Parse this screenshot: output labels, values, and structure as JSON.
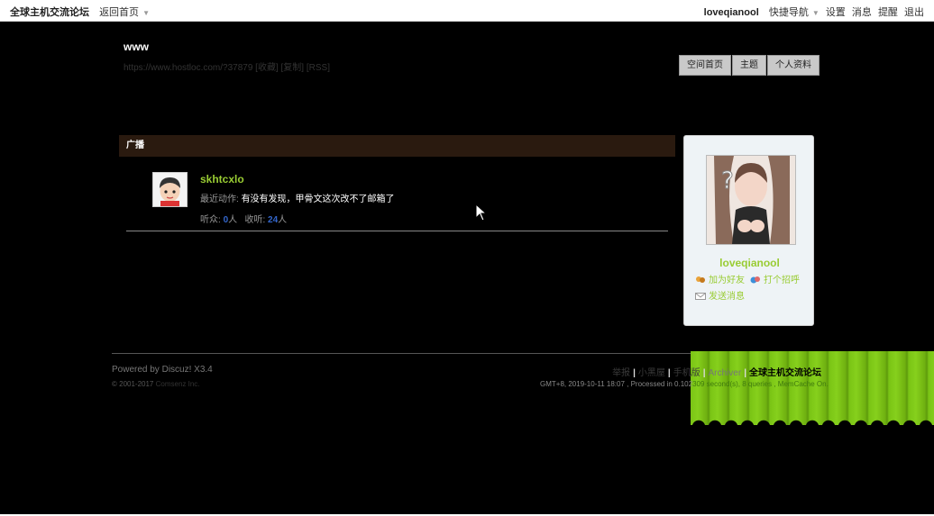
{
  "topbar": {
    "site_name": "全球主机交流论坛",
    "home": "返回首页",
    "username": "loveqianool",
    "quick_nav": "快捷导航",
    "settings": "设置",
    "messages": "消息",
    "reminders": "提醒",
    "logout": "退出"
  },
  "space": {
    "title": "www",
    "url": "https://www.hostloc.com/?37879 [收藏] [复制] [RSS]"
  },
  "nav_tabs": [
    "空间首页",
    "主题",
    "个人资料"
  ],
  "feed": {
    "header": "广播",
    "user": "skhtcxlo",
    "action_label": "最近动作:",
    "action_text": "有没有发现，甲骨文这次改不了邮箱了",
    "listeners_label": "听众:",
    "listeners": "0",
    "listening_label": "收听:",
    "listening": "24",
    "unit": "人"
  },
  "profile": {
    "name": "loveqianool",
    "add_friend": "加为好友",
    "greet": "打个招呼",
    "send_message": "发送消息"
  },
  "footer": {
    "powered_text": "Powered by",
    "powered_link": "Discuz!",
    "version": "X3.4",
    "copyright": "© 2001-2017",
    "company": "Comsenz Inc.",
    "links": [
      "举报",
      "小黑屋",
      "手机版",
      "Archiver",
      "全球主机交流论坛"
    ],
    "timeinfo": "GMT+8, 2019-10-11 18:07 , Processed in 0.102",
    "queries": "309 second(s), 8 queries , MemCache On."
  }
}
